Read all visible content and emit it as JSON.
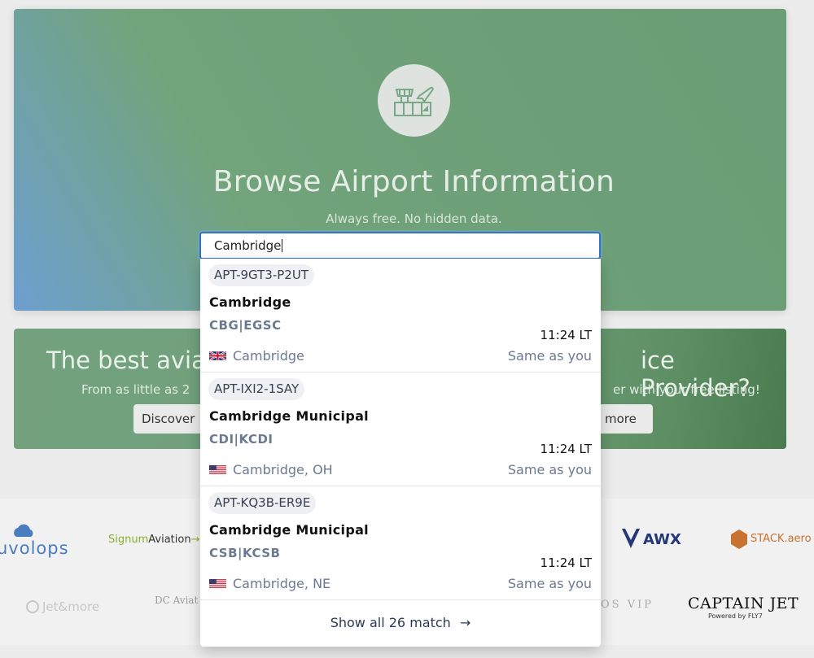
{
  "hero": {
    "title": "Browse Airport Information",
    "subtitle": "Always free. No hidden data.",
    "icon": "airport-tower-plane-icon"
  },
  "search": {
    "value": "Cambridge"
  },
  "banner": {
    "title_left": "The best avia",
    "title_right": "ice Provider?",
    "sub_left": "From as little as 2",
    "sub_right": "er with your free listing!",
    "btn_left": "Discover",
    "btn_right": "e more"
  },
  "results": [
    {
      "id": "APT-9GT3-P2UT",
      "name": "Cambridge",
      "codes": "CBG|EGSC",
      "time": "11:24 LT",
      "location": "Cambridge",
      "flag": "uk-flag-icon",
      "relative": "Same as you"
    },
    {
      "id": "APT-IXI2-1SAY",
      "name": "Cambridge Municipal",
      "codes": "CDI|KCDI",
      "time": "11:24 LT",
      "location": "Cambridge, OH",
      "flag": "us-flag-icon",
      "relative": "Same as you"
    },
    {
      "id": "APT-KQ3B-ER9E",
      "name": "Cambridge Municipal",
      "codes": "CSB|KCSB",
      "time": "11:24 LT",
      "location": "Cambridge, NE",
      "flag": "us-flag-icon",
      "relative": "Same as you"
    }
  ],
  "show_all": "Show all 26 match",
  "logos": {
    "uvolops": "uvolops",
    "signum_a": "Signum",
    "signum_b": "Aviation",
    "awx": "AWX",
    "stack": "STACK.aero",
    "jetmore": "Jet&more",
    "dc": "DC Aviat",
    "vip": "OS VIP",
    "captain": "CAPTAIN JET",
    "captain_sub": "Powered by FLY7"
  }
}
